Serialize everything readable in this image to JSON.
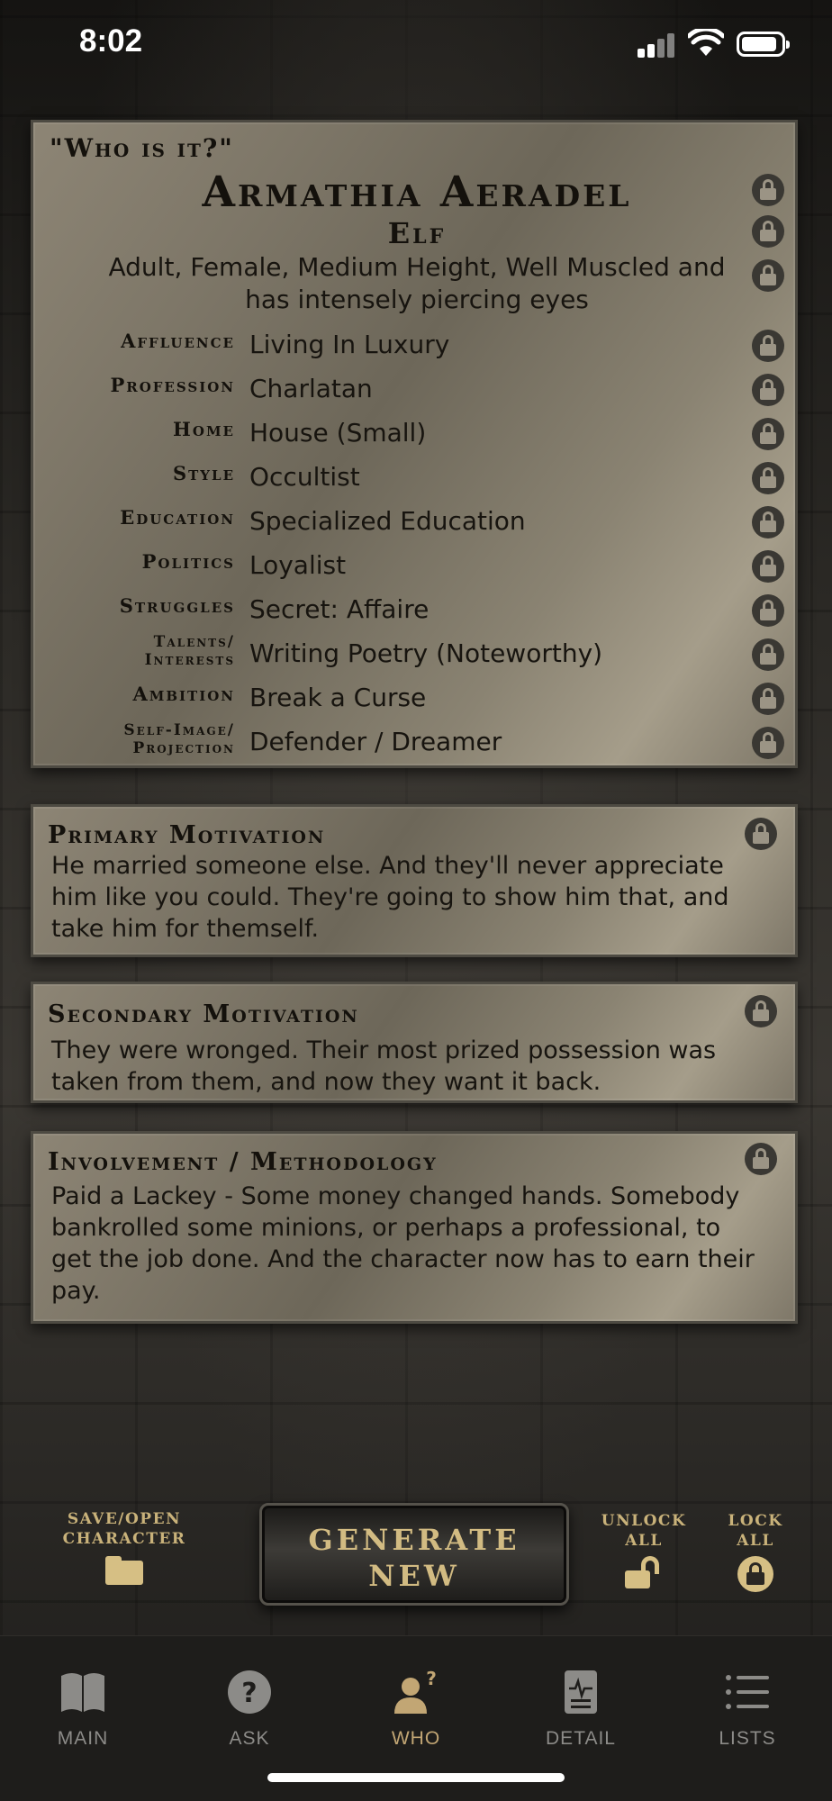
{
  "status_bar": {
    "time": "8:02"
  },
  "who_card": {
    "title": "\"Who is it?\"",
    "name": "Armathia Aeradel",
    "race": "Elf",
    "description": "Adult, Female, Medium Height, Well Muscled and has intensely piercing eyes",
    "attributes": [
      {
        "label": "Affluence",
        "value": "Living In Luxury"
      },
      {
        "label": "Profession",
        "value": "Charlatan"
      },
      {
        "label": "Home",
        "value": "House (Small)"
      },
      {
        "label": "Style",
        "value": "Occultist"
      },
      {
        "label": "Education",
        "value": "Specialized Education"
      },
      {
        "label": "Politics",
        "value": "Loyalist"
      },
      {
        "label": "Struggles",
        "value": "Secret: Affaire"
      },
      {
        "label": "Talents/\nInterests",
        "value": "Writing Poetry (Noteworthy)"
      },
      {
        "label": "Ambition",
        "value": "Break a Curse"
      },
      {
        "label": "Self-Image/\nProjection",
        "value": "Defender / Dreamer"
      }
    ]
  },
  "primary_motivation": {
    "title": "Primary Motivation",
    "text": "He married someone else. And they'll never appreciate him like you could. They're going to show him that, and take him for themself."
  },
  "secondary_motivation": {
    "title": "Secondary Motivation",
    "text": "They were wronged. Their most prized possession was taken from them, and now they want it back."
  },
  "involvement": {
    "title": "Involvement / Methodology",
    "text": "Paid a Lackey - Some money changed hands. Somebody bankrolled some minions, or perhaps a professional, to get the job done. And the character now has to earn their pay."
  },
  "actions": {
    "save_open_label": "SAVE/OPEN\nCHARACTER",
    "generate_label": "GENERATE\nNEW",
    "unlock_all_label": "UNLOCK\nALL",
    "lock_all_label": "LOCK\nALL"
  },
  "tab_bar": {
    "active": "WHO",
    "accent_color": "#c2a674",
    "items": [
      {
        "label": "MAIN",
        "icon": "book-icon"
      },
      {
        "label": "ASK",
        "icon": "question-icon"
      },
      {
        "label": "WHO",
        "icon": "person-question-icon"
      },
      {
        "label": "DETAIL",
        "icon": "document-icon"
      },
      {
        "label": "LISTS",
        "icon": "list-icon"
      }
    ]
  }
}
